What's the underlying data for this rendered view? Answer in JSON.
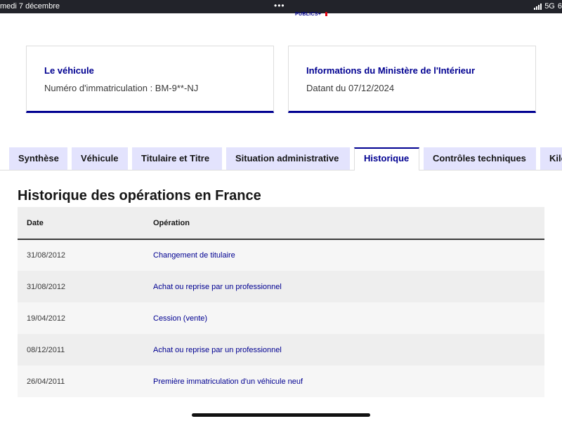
{
  "status_bar": {
    "date": "medi 7 décembre",
    "dots": "•••",
    "network": "5G",
    "battery": "6"
  },
  "header": {
    "logo_fragment": "PUBLICS+"
  },
  "cards": {
    "vehicle": {
      "title": "Le véhicule",
      "text": "Numéro d'immatriculation : BM-9**-NJ"
    },
    "ministry": {
      "title": "Informations du Ministère de l'Intérieur",
      "text": "Datant du 07/12/2024"
    }
  },
  "tabs": [
    {
      "label": "Synthèse",
      "active": false
    },
    {
      "label": "Véhicule",
      "active": false
    },
    {
      "label": "Titulaire et Titre",
      "active": false
    },
    {
      "label": "Situation administrative",
      "active": false
    },
    {
      "label": "Historique",
      "active": true
    },
    {
      "label": "Contrôles techniques",
      "active": false
    },
    {
      "label": "Kilo",
      "active": false
    }
  ],
  "history": {
    "title": "Historique des opérations en France",
    "columns": [
      "Date",
      "Opération"
    ],
    "rows": [
      {
        "date": "31/08/2012",
        "operation": "Changement de titulaire"
      },
      {
        "date": "31/08/2012",
        "operation": "Achat ou reprise par un professionnel"
      },
      {
        "date": "19/04/2012",
        "operation": "Cession (vente)"
      },
      {
        "date": "08/12/2011",
        "operation": "Achat ou reprise par un professionnel"
      },
      {
        "date": "26/04/2011",
        "operation": "Première immatriculation d'un véhicule neuf"
      }
    ]
  },
  "colors": {
    "primary": "#000091",
    "tab_bg": "#e3e3fd",
    "table_header_bg": "#eeeeee"
  }
}
